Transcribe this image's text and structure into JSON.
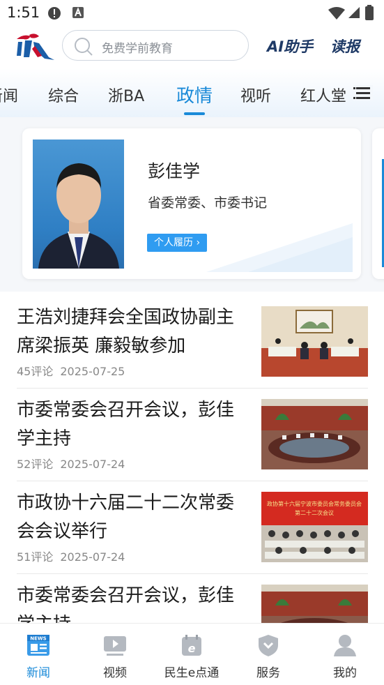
{
  "status_bar": {
    "time": "1:51"
  },
  "header": {
    "search_placeholder": "免费学前教育",
    "ai_label": "AI助手",
    "read_label": "读报"
  },
  "tabs": {
    "items": [
      "新闻",
      "综合",
      "浙BA",
      "政情",
      "视听",
      "红人堂"
    ],
    "active": "政情"
  },
  "profile": {
    "name": "彭佳学",
    "title": "省委常委、市委书记",
    "resume_button": "个人履历 ›"
  },
  "news": [
    {
      "title": "王浩刘捷拜会全国政协副主席梁振英 廉毅敏参加",
      "comments": "45评论",
      "date": "2025-07-25"
    },
    {
      "title": "市委常委会召开会议，彭佳学主持",
      "comments": "52评论",
      "date": "2025-07-24"
    },
    {
      "title": "市政协十六届二十二次常委会会议举行",
      "comments": "51评论",
      "date": "2025-07-24"
    },
    {
      "title": "市委常委会召开会议，彭佳学主持",
      "comments": "",
      "date": ""
    }
  ],
  "thumb_text": {
    "banner_line1": "政协第十六届宁波市委员会常务委员会",
    "banner_line2": "第二十二次会议"
  },
  "bottom_nav": {
    "items": [
      {
        "label": "新闻",
        "icon": "news-icon"
      },
      {
        "label": "视频",
        "icon": "video-icon"
      },
      {
        "label": "民生e点通",
        "icon": "calendar-e-icon"
      },
      {
        "label": "服务",
        "icon": "shield-icon"
      },
      {
        "label": "我的",
        "icon": "user-icon"
      }
    ],
    "active": "新闻"
  },
  "colors": {
    "accent": "#1a8ad8",
    "brand_dark": "#1f3a66"
  }
}
